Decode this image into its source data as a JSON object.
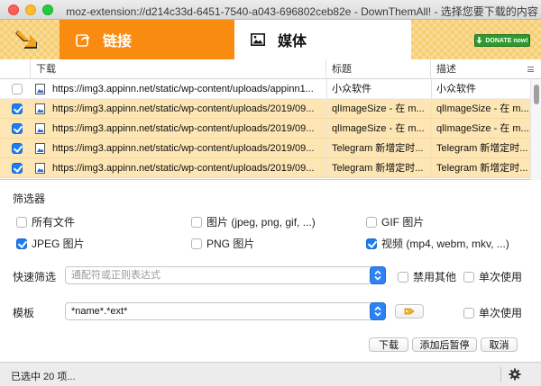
{
  "window": {
    "title": "moz-extension://d214c33d-6451-7540-a043-696802ceb82e - DownThemAll! - 选择您要下载的内容"
  },
  "tabs": {
    "links_label": "链接",
    "media_label": "媒体"
  },
  "donate": {
    "label": "DONATE now!"
  },
  "table": {
    "columns": {
      "download": "下载",
      "title": "标题",
      "description": "描述"
    },
    "rows": [
      {
        "checked": false,
        "url": "https://img3.appinn.net/static/wp-content/uploads/appinn1...",
        "title": "小众软件",
        "description": "小众软件"
      },
      {
        "checked": true,
        "url": "https://img3.appinn.net/static/wp-content/uploads/2019/09...",
        "title": "qlImageSize - 在 m...",
        "description": "qlImageSize - 在 m..."
      },
      {
        "checked": true,
        "url": "https://img3.appinn.net/static/wp-content/uploads/2019/09...",
        "title": "qlImageSize - 在 m...",
        "description": "qlImageSize - 在 m..."
      },
      {
        "checked": true,
        "url": "https://img3.appinn.net/static/wp-content/uploads/2019/09...",
        "title": "Telegram 新增定时...",
        "description": "Telegram 新增定时..."
      },
      {
        "checked": true,
        "url": "https://img3.appinn.net/static/wp-content/uploads/2019/09...",
        "title": "Telegram 新增定时...",
        "description": "Telegram 新增定时..."
      }
    ]
  },
  "filters": {
    "heading": "筛选器",
    "items": [
      {
        "label": "所有文件",
        "checked": false
      },
      {
        "label": "图片 (jpeg, png, gif, ...)",
        "checked": false
      },
      {
        "label": "GIF 图片",
        "checked": false
      },
      {
        "label": "JPEG 图片",
        "checked": true
      },
      {
        "label": "PNG 图片",
        "checked": false
      },
      {
        "label": "视频 (mp4, webm, mkv, ...)",
        "checked": true
      }
    ]
  },
  "quick_filter": {
    "label": "快速筛选",
    "placeholder": "通配符或正则表达式",
    "value": "",
    "disable_others_label": "禁用其他",
    "once_label": "单次使用"
  },
  "mask": {
    "label": "模板",
    "value": "*name*.*ext*",
    "once_label": "单次使用"
  },
  "buttons": {
    "download": "下载",
    "add_paused": "添加后暂停",
    "cancel": "取消"
  },
  "status": {
    "text": "已选中 20 项..."
  },
  "colors": {
    "header_orange": "#f98b10",
    "selection": "#fde6b4",
    "accent_blue": "#1a7df5",
    "donate_green": "#2e9b2e"
  }
}
